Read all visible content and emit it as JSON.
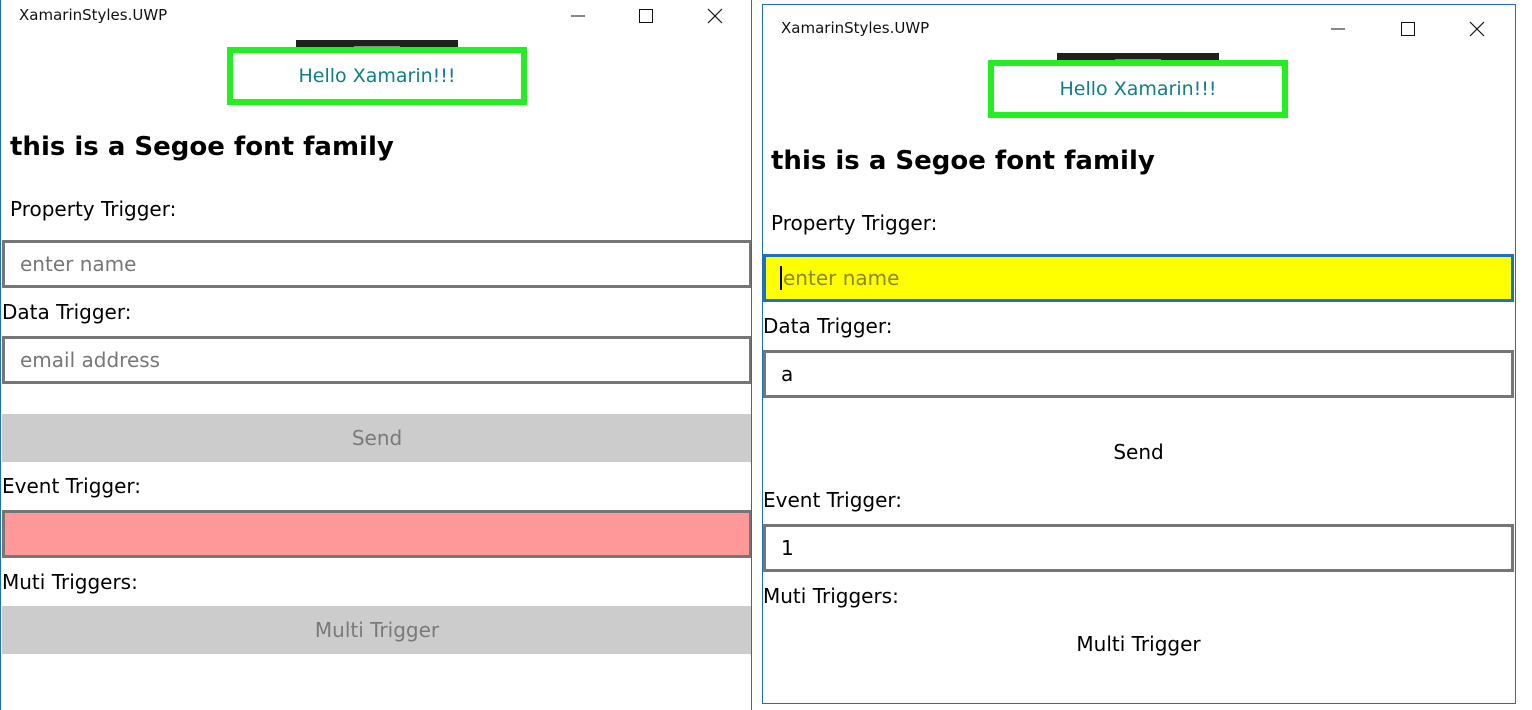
{
  "left": {
    "title": "XamarinStyles.UWP",
    "hello": "Hello Xamarin!!!",
    "heading": "this is a Segoe font family",
    "property_trigger_label": "Property Trigger:",
    "name_placeholder": "enter name",
    "data_trigger_label": "Data Trigger:",
    "email_placeholder": "email address",
    "send_label": "Send",
    "event_trigger_label": "Event Trigger:",
    "event_value": "",
    "multi_label": "Muti Triggers:",
    "multi_button": "Multi Trigger"
  },
  "right": {
    "title": "XamarinStyles.UWP",
    "hello": "Hello Xamarin!!!",
    "heading": "this is a Segoe font family",
    "property_trigger_label": "Property Trigger:",
    "name_placeholder": "enter name",
    "data_trigger_label": "Data Trigger:",
    "email_value": "a",
    "send_label": "Send",
    "event_trigger_label": "Event Trigger:",
    "event_value": "1",
    "multi_label": "Muti Triggers:",
    "multi_button": "Multi Trigger"
  },
  "colors": {
    "hello_border": "#22ee22",
    "hello_text": "#0d7f86",
    "focused_field_bg": "#ffff00",
    "focused_field_border": "#1f6fbf",
    "event_invalid_bg": "#ff9999",
    "disabled_button_bg": "#cccccc"
  },
  "icons": [
    "minimize-icon",
    "maximize-icon",
    "close-icon"
  ]
}
